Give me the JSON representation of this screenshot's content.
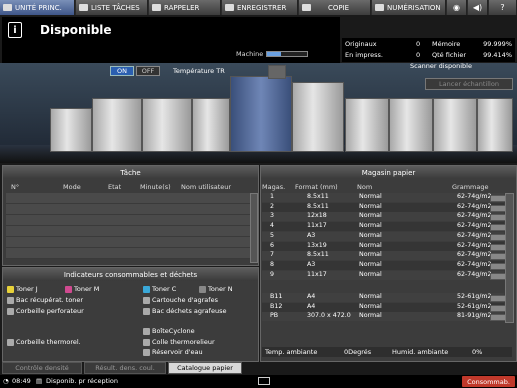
{
  "tabs": [
    {
      "label": "UNITÉ PRINC.",
      "icon": "printer-icon",
      "active": true
    },
    {
      "label": "LISTE TÂCHES",
      "icon": "list-icon",
      "active": false
    },
    {
      "label": "RAPPELER",
      "icon": "recall-icon",
      "active": false
    },
    {
      "label": "ENREGISTRER",
      "icon": "save-icon",
      "active": false
    },
    {
      "label": "COPIE",
      "icon": "copy-icon",
      "active": false
    },
    {
      "label": "NUMÉRISATION",
      "icon": "scan-icon",
      "active": false
    }
  ],
  "header": {
    "status": "Disponible",
    "machine_label": "Machine",
    "machine_level": 0.35
  },
  "counters": {
    "originals_label": "Originaux",
    "originals_value": "0",
    "memory_label": "Mémoire",
    "memory_value": "99.999%",
    "printing_label": "En impress.",
    "printing_value": "0",
    "file_label": "Qté fichier",
    "file_value": "99.414%"
  },
  "machine": {
    "on_label": "ON",
    "off_label": "OFF",
    "temp_label": "Température TR",
    "scanner_status": "Scanner disponible",
    "sample_button": "Lancer échantillon"
  },
  "job_panel": {
    "title": "Tâche",
    "columns": [
      "N°",
      "Mode",
      "Etat",
      "Minute(s)",
      "Nom utilisateur"
    ]
  },
  "consumables": {
    "title": "Indicateurs consommables et déchets",
    "items": [
      "Toner J",
      "Toner M",
      "Toner C",
      "Toner N",
      "Bac récupérat. toner",
      "Cartouche d'agrafes",
      "Corbeille perforateur",
      "Bac déchets agrafeuse",
      "BoîteCyclone",
      "Corbeille thermorel.",
      "Colle thermorelieur",
      "Réservoir d'eau"
    ]
  },
  "trays": {
    "title": "Magasin papier",
    "columns": [
      "Magas.",
      "Format (mm)",
      "Nom",
      "Grammage"
    ],
    "rows": [
      {
        "id": "1",
        "size": "8.5x11",
        "name": "Normal",
        "weight": "62-74g/m2"
      },
      {
        "id": "2",
        "size": "8.5x11",
        "name": "Normal",
        "weight": "62-74g/m2"
      },
      {
        "id": "3",
        "size": "12x18",
        "name": "Normal",
        "weight": "62-74g/m2"
      },
      {
        "id": "4",
        "size": "11x17",
        "name": "Normal",
        "weight": "62-74g/m2"
      },
      {
        "id": "5",
        "size": "A3",
        "name": "Normal",
        "weight": "62-74g/m2"
      },
      {
        "id": "6",
        "size": "13x19",
        "name": "Normal",
        "weight": "62-74g/m2"
      },
      {
        "id": "7",
        "size": "8.5x11",
        "name": "Normal",
        "weight": "62-74g/m2"
      },
      {
        "id": "8",
        "size": "A3",
        "name": "Normal",
        "weight": "62-74g/m2"
      },
      {
        "id": "9",
        "size": "11x17",
        "name": "Normal",
        "weight": "62-74g/m2"
      }
    ],
    "extra_rows": [
      {
        "id": "B11",
        "size": "A4",
        "name": "Normal",
        "weight": "52-61g/m2"
      },
      {
        "id": "B12",
        "size": "A4",
        "name": "Normal",
        "weight": "52-61g/m2"
      },
      {
        "id": "PB",
        "size": "307.0 x 472.0",
        "name": "Normal",
        "weight": "81-91g/m2"
      }
    ],
    "temp_label": "Temp. ambiante",
    "temp_value": "0Degrés",
    "humid_label": "Humid. ambiante",
    "humid_value": "0%"
  },
  "bottom_tabs": [
    {
      "label": "Contrôle densité",
      "active": false
    },
    {
      "label": "Résult. dens. coul.",
      "active": false
    },
    {
      "label": "Catalogue papier",
      "active": true
    }
  ],
  "footer": {
    "time": "08:49",
    "status": "Disponib. pr réception",
    "badge": "Consommab."
  }
}
